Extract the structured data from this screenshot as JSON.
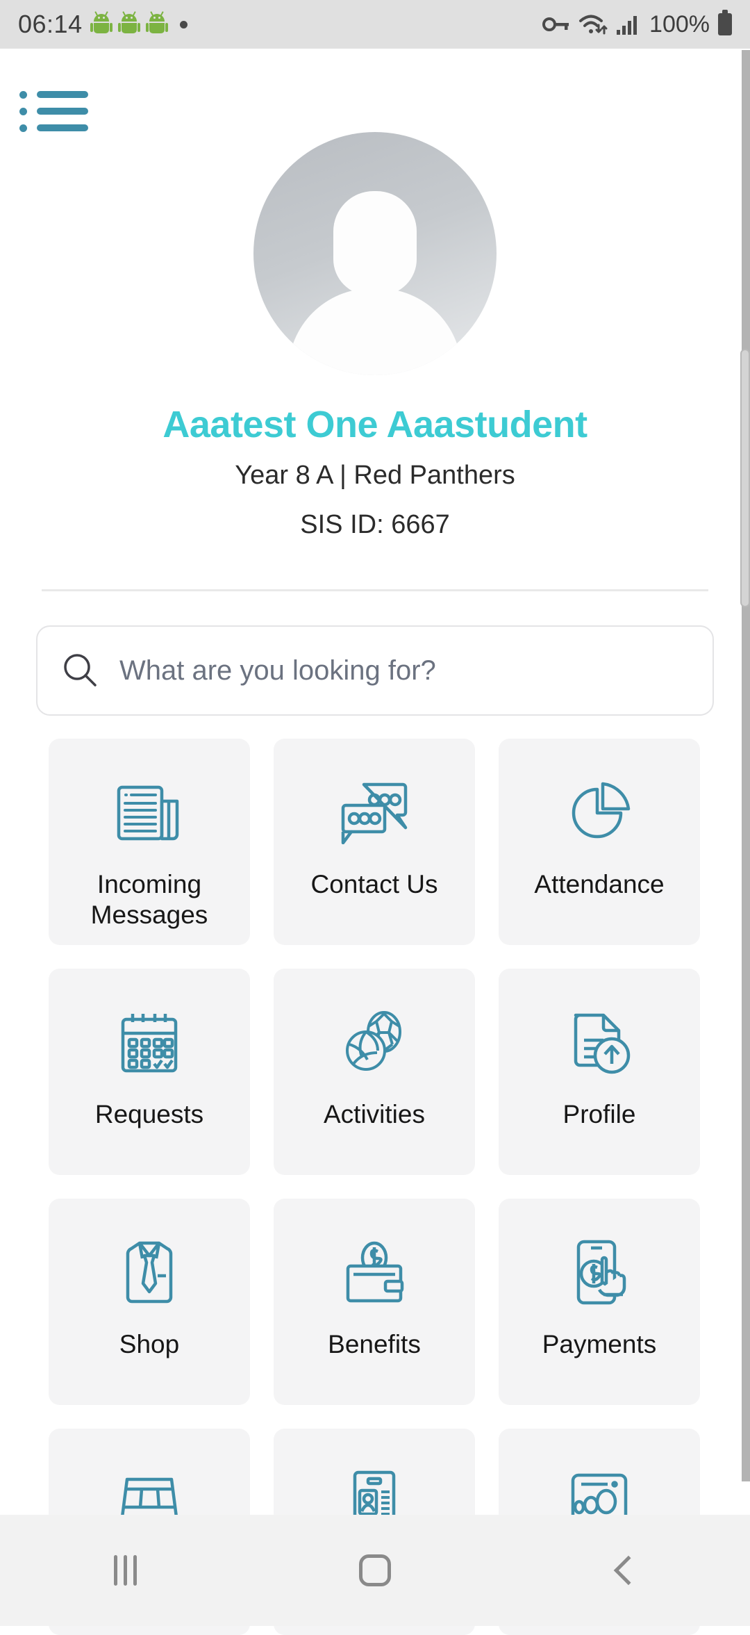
{
  "status_bar": {
    "time": "06:14",
    "battery_percent": "100%",
    "icons": [
      "android-robot-icon",
      "android-robot-icon",
      "android-robot-icon",
      "dot-icon",
      "vpn-key-icon",
      "wifi-icon",
      "cellular-signal-icon",
      "battery-icon"
    ]
  },
  "header": {
    "menu_icon": "list-menu-icon"
  },
  "profile": {
    "avatar_icon": "default-person-avatar",
    "name": "Aaatest One Aaastudent",
    "class_info": "Year 8 A | Red Panthers",
    "sis_id": "SIS ID: 6667",
    "name_color": "#3dcbd3"
  },
  "search": {
    "placeholder": "What are you looking for?",
    "value": "",
    "icon": "search-icon"
  },
  "tiles": [
    {
      "label": "Incoming Messages",
      "icon": "newspaper-icon"
    },
    {
      "label": "Contact Us",
      "icon": "chat-bubbles-icon"
    },
    {
      "label": "Attendance",
      "icon": "pie-chart-icon"
    },
    {
      "label": "Requests",
      "icon": "calendar-check-icon"
    },
    {
      "label": "Activities",
      "icon": "sports-balls-icon"
    },
    {
      "label": "Profile",
      "icon": "document-upload-icon"
    },
    {
      "label": "Shop",
      "icon": "shirt-tie-icon"
    },
    {
      "label": "Benefits",
      "icon": "wallet-coin-icon"
    },
    {
      "label": "Payments",
      "icon": "phone-tap-pay-icon"
    },
    {
      "label": "",
      "icon": "bus-icon"
    },
    {
      "label": "",
      "icon": "id-card-icon"
    },
    {
      "label": "",
      "icon": "group-people-icon"
    }
  ],
  "theme": {
    "icon_color": "#3e8da8",
    "tile_background": "#f4f4f5",
    "accent": "#3dcbd3"
  },
  "nav_bar": {
    "recents_label": "recents-icon",
    "home_label": "home-icon",
    "back_label": "back-icon"
  }
}
